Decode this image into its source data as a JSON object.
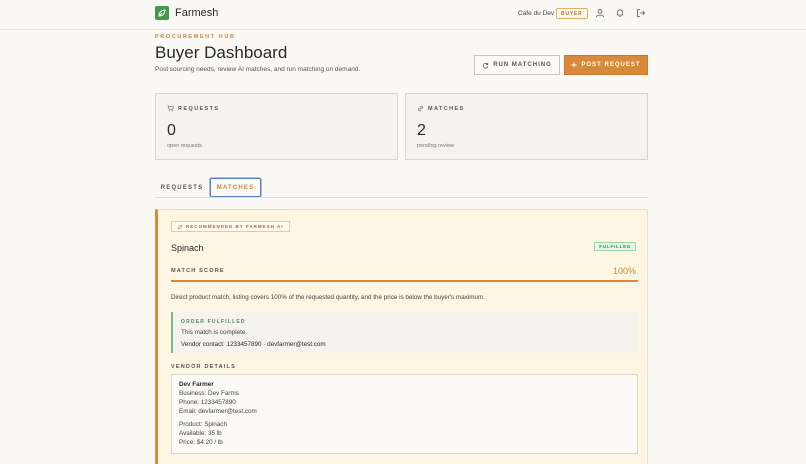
{
  "header": {
    "brand": "Farmesh",
    "account_name": "Cafe du Dev",
    "role_badge": "BUYER",
    "icons": [
      "leaf-logo-icon",
      "user-icon",
      "bell-icon",
      "logout-icon"
    ]
  },
  "page": {
    "eyebrow": "PROCUREMENT HUB",
    "title": "Buyer Dashboard",
    "subtitle": "Post sourcing needs, review AI matches, and run matching on demand.",
    "run_matching_label": "RUN MATCHING",
    "post_request_label": "POST REQUEST"
  },
  "stats": {
    "requests": {
      "label": "REQUESTS",
      "value": "0",
      "caption": "open requests",
      "icon": "cart-icon"
    },
    "matches": {
      "label": "MATCHES",
      "value": "2",
      "caption": "pending review",
      "icon": "link-icon"
    }
  },
  "tabs": [
    {
      "label": "REQUESTS",
      "active": false
    },
    {
      "label": "MATCHES",
      "active": true
    }
  ],
  "match": {
    "ai_badge": "RECOMMENDED BY FARMESH AI",
    "product": "Spinach",
    "status": "FULFILLED",
    "score_label": "MATCH SCORE",
    "score_text": "100%",
    "score_fraction": 1.0,
    "description": "Direct product match, listing covers 100% of the requested quantity, and the price is below the buyer's maximum.",
    "order": {
      "heading": "ORDER FULFILLED",
      "line1": "This match is complete.",
      "line2": "Vendor contact: 1233457890 · devfarmer@test.com"
    },
    "vendor": {
      "heading": "VENDOR DETAILS",
      "name": "Dev Farmer",
      "business": "Business: Dev Farms",
      "phone": "Phone: 1233457890",
      "email": "Email: devfarmer@test.com",
      "product": "Product: Spinach",
      "available": "Available: 35 lb",
      "price": "Price: $4.20 / lb"
    }
  },
  "colors": {
    "accent": "#d8893a",
    "brand_green": "#3f9a4a",
    "fulfilled_green": "#3a8a4a",
    "card_bg": "#fdf6e3"
  }
}
